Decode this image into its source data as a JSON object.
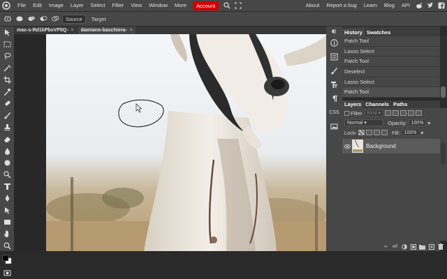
{
  "menubar": {
    "items": [
      "File",
      "Edit",
      "Image",
      "Layer",
      "Select",
      "Filter",
      "View",
      "Window",
      "More"
    ],
    "account_label": "Account",
    "right_items": [
      "About",
      "Report a bug",
      "Learn",
      "Blog",
      "API"
    ]
  },
  "options": {
    "source_label": "Source",
    "target_label": "Target"
  },
  "tabs": [
    {
      "label": "max-s-Rd1kPbxVP5Q-",
      "close": "×"
    },
    {
      "label": "damiano-baschiera-",
      "close": "×"
    }
  ],
  "sidecol": {
    "info_label": "i",
    "css_label": "CSS"
  },
  "history_panel": {
    "tabs": [
      "History",
      "Swatches"
    ],
    "rows": [
      "Patch Tool",
      "Lasso Select",
      "Patch Tool",
      "Deselect",
      "Lasso Select",
      "Patch Tool"
    ]
  },
  "layers_panel": {
    "tabs": [
      "Layers",
      "Channels",
      "Paths"
    ],
    "filter_label": "Filter",
    "kind_label": "Kind",
    "blend_mode": "Normal",
    "opacity_label": "Opacity:",
    "opacity_value": "100%",
    "lock_label": "Lock:",
    "fill_label": "Fill:",
    "fill_value": "100%",
    "layers": [
      {
        "name": "Background"
      }
    ],
    "bottom_labels": {
      "link": "∞",
      "eff": "eff"
    }
  },
  "colors": {
    "accent": "#d40000",
    "panel": "#474747",
    "background": "#282828"
  }
}
